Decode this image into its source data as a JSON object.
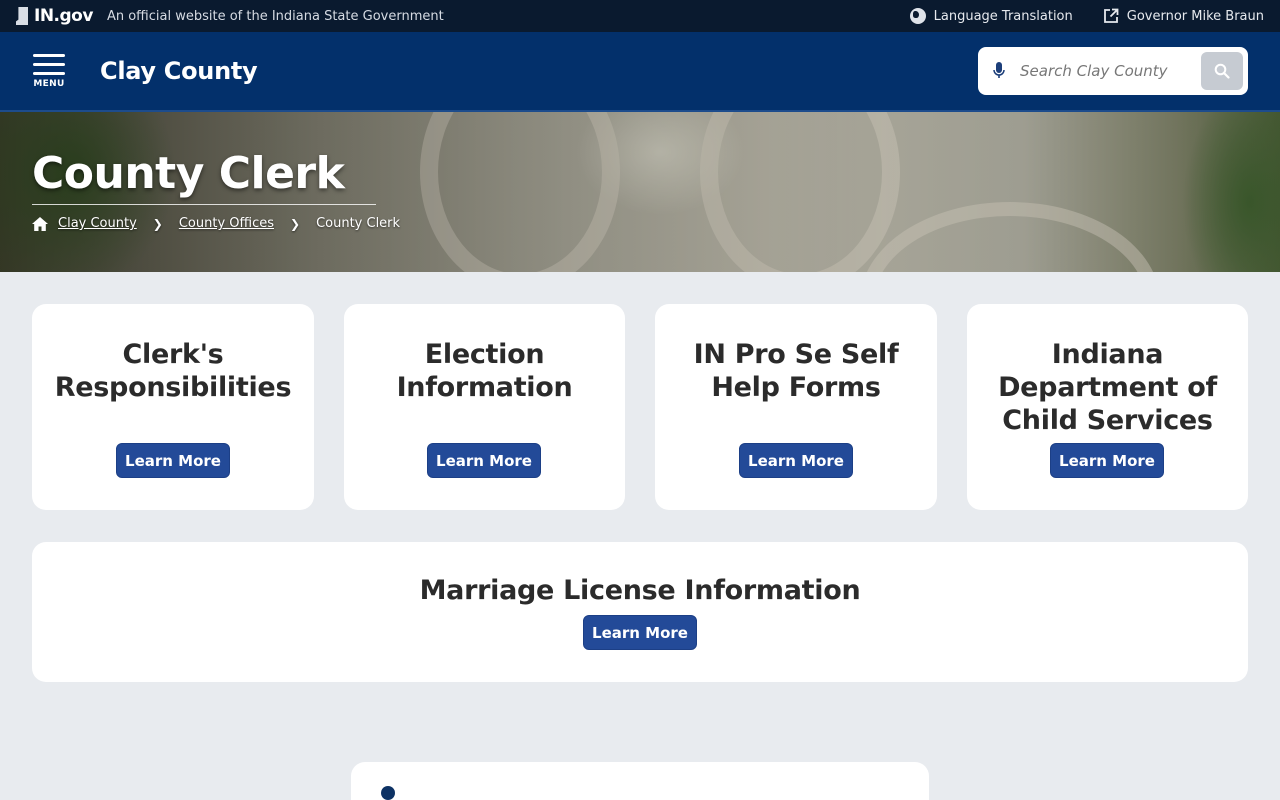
{
  "topbar": {
    "logo_text": "IN.gov",
    "official_text": "An official website of the Indiana State Government",
    "language_label": "Language Translation",
    "governor_label": "Governor Mike Braun"
  },
  "header": {
    "menu_label": "MENU",
    "site_title": "Clay County",
    "search_placeholder": "Search Clay County"
  },
  "hero": {
    "title": "County Clerk",
    "breadcrumb": [
      "Clay County",
      "County Offices",
      "County Clerk"
    ]
  },
  "cards": [
    {
      "title": "Clerk's Responsibilities",
      "button": "Learn More"
    },
    {
      "title": "Election Information",
      "button": "Learn More"
    },
    {
      "title": "IN Pro Se Self Help Forms",
      "button": "Learn More"
    },
    {
      "title": "Indiana Department of Child Services",
      "button": "Learn More"
    },
    {
      "title": "Marriage License Information",
      "button": "Learn More"
    }
  ],
  "colors": {
    "topbar_bg": "#0a1a2f",
    "header_bg": "#03306b",
    "button_bg": "#234a98",
    "page_bg": "#e8ebef"
  }
}
